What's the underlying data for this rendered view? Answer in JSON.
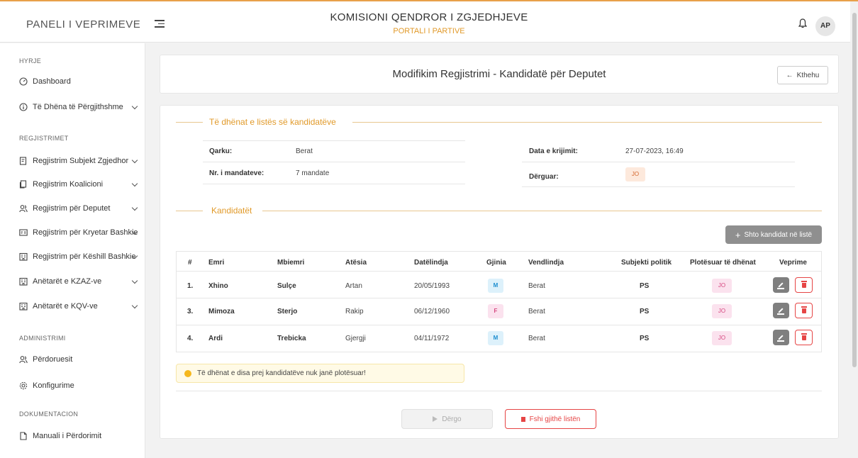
{
  "header": {
    "brand": "PANELI I VEPRIMEVE",
    "title": "KOMISIONI QENDROR I ZGJEDHJEVE",
    "subtitle": "PORTALI I PARTIVE",
    "avatar": "AP"
  },
  "sidebar": {
    "sections": [
      {
        "title": "HYRJE",
        "items": [
          {
            "label": "Dashboard",
            "icon": "dashboard-icon"
          },
          {
            "label": "Të Dhëna të Përgjithshme",
            "icon": "info-icon",
            "expandable": true
          }
        ]
      },
      {
        "title": "REGJISTRIMET",
        "items": [
          {
            "label": "Regjistrim Subjekt Zgjedhor",
            "icon": "document-icon",
            "expandable": true
          },
          {
            "label": "Regjistrim Koalicioni",
            "icon": "copy-icon",
            "expandable": true
          },
          {
            "label": "Regjistrim për Deputet",
            "icon": "users-icon",
            "expandable": true
          },
          {
            "label": "Regjistrim për Kryetar Bashkie",
            "icon": "id-card-icon",
            "expandable": true
          },
          {
            "label": "Regjistrim për Këshill Bashkie",
            "icon": "building-icon",
            "expandable": true
          },
          {
            "label": "Anëtarët e KZAZ-ve",
            "icon": "building-icon",
            "expandable": true
          },
          {
            "label": "Anëtarët e KQV-ve",
            "icon": "building-icon",
            "expandable": true
          }
        ]
      },
      {
        "title": "ADMINISTRIMI",
        "items": [
          {
            "label": "Përdoruesit",
            "icon": "users-icon"
          },
          {
            "label": "Konfigurime",
            "icon": "gear-icon"
          }
        ]
      },
      {
        "title": "DOKUMENTACION",
        "items": [
          {
            "label": "Manuali i Përdorimit",
            "icon": "file-icon"
          }
        ]
      }
    ]
  },
  "page": {
    "title": "Modifikim Regjistrimi - Kandidatë për Deputet",
    "back_label": "Kthehu"
  },
  "list_info": {
    "legend": "Të dhënat e listës së kandidatëve",
    "qarku_label": "Qarku:",
    "qarku_value": "Berat",
    "mandates_label": "Nr. i mandateve:",
    "mandates_value": "7 mandate",
    "created_label": "Data e krijimit:",
    "created_value": "27-07-2023, 16:49",
    "sent_label": "Dërguar:",
    "sent_value": "JO"
  },
  "candidates": {
    "legend": "Kandidatët",
    "add_label": "Shto kandidat në listë",
    "columns": [
      "#",
      "Emri",
      "Mbiemri",
      "Atësia",
      "Datëlindja",
      "Gjinia",
      "Vendlindja",
      "Subjekti politik",
      "Plotësuar të dhënat",
      "Veprime"
    ],
    "rows": [
      {
        "num": "1.",
        "name": "Xhino",
        "surname": "Sulçe",
        "father": "Artan",
        "dob": "20/05/1993",
        "gender": "M",
        "birthplace": "Berat",
        "party": "PS",
        "complete": "JO"
      },
      {
        "num": "3.",
        "name": "Mimoza",
        "surname": "Sterjo",
        "father": "Rakip",
        "dob": "06/12/1960",
        "gender": "F",
        "birthplace": "Berat",
        "party": "PS",
        "complete": "JO"
      },
      {
        "num": "4.",
        "name": "Ardi",
        "surname": "Trebicka",
        "father": "Gjergji",
        "dob": "04/11/1972",
        "gender": "M",
        "birthplace": "Berat",
        "party": "PS",
        "complete": "JO"
      }
    ],
    "warning": "Të dhënat e disa prej kandidatëve nuk janë plotësuar!"
  },
  "actions": {
    "send_label": "Dërgo",
    "delete_all_label": "Fshi gjithë listën"
  },
  "colors": {
    "accent": "#e19a2a",
    "danger": "#e64545",
    "male_badge": "#1e8ed0",
    "female_badge": "#d6477f"
  }
}
